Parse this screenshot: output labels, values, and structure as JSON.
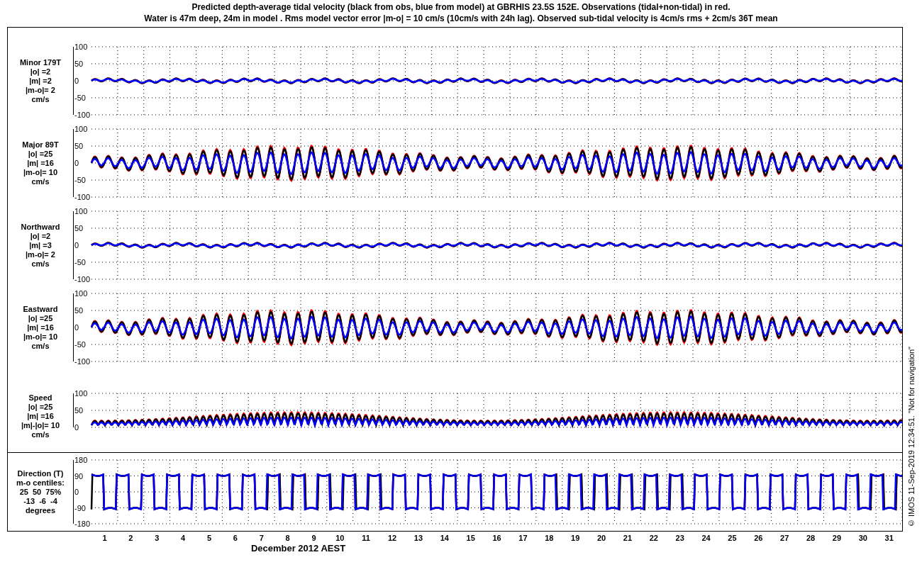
{
  "title_lines": [
    "Predicted depth-average tidal velocity (black from obs, blue from model) at GBRHIS 23.5S 152E. Observations (tidal+non-tidal) in red.",
    "Water is 47m deep, 24m in model . Rms model vector error |m-o| = 10 cm/s (10cm/s with 24h lag). Observed sub-tidal velocity is 4cm/s rms + 2cm/s 36T mean"
  ],
  "panels": [
    {
      "kind": "flat",
      "label_lines": [
        "Minor 179T",
        "|o| =2",
        "|m| =2",
        "|m-o|= 2",
        "cm/s"
      ],
      "yticks": [
        "100",
        "50",
        "0",
        "-50",
        "-100"
      ]
    },
    {
      "kind": "tidal",
      "label_lines": [
        "Major 89T",
        "|o| =25",
        "|m| =16",
        "|m-o|= 10",
        "cm/s"
      ],
      "yticks": [
        "100",
        "50",
        "0",
        "-50",
        "-100"
      ]
    },
    {
      "kind": "flat",
      "label_lines": [
        "Northward",
        "|o| =2",
        "|m| =3",
        "|m-o|= 2",
        "cm/s"
      ],
      "yticks": [
        "100",
        "50",
        "0",
        "-50",
        "-100"
      ]
    },
    {
      "kind": "tidal",
      "label_lines": [
        "Eastward",
        "|o| =25",
        "|m| =16",
        "|m-o|= 10",
        "cm/s"
      ],
      "yticks": [
        "100",
        "50",
        "0",
        "-50",
        "-100"
      ]
    },
    {
      "kind": "speed",
      "label_lines": [
        "Speed",
        "|o| =25",
        "|m| =16",
        "|m|-|o|= 10",
        "cm/s"
      ],
      "yticks": [
        "100",
        "50",
        "0"
      ]
    }
  ],
  "direction_panel": {
    "kind": "direction",
    "label_lines": [
      "Direction (T)",
      "m-o centiles:",
      "25  50  75%",
      "-13  -6  -4",
      "degrees"
    ],
    "yticks": [
      "180",
      "90",
      "0",
      "-90",
      "-180"
    ]
  },
  "x_axis": {
    "day_labels": [
      "1",
      "2",
      "3",
      "4",
      "5",
      "6",
      "7",
      "8",
      "9",
      "10",
      "11",
      "12",
      "13",
      "14",
      "15",
      "16",
      "17",
      "18",
      "19",
      "20",
      "21",
      "22",
      "23",
      "24",
      "25",
      "26",
      "27",
      "28",
      "29",
      "30",
      "31"
    ],
    "label": "December 2012 AEST"
  },
  "side_note": "© IMOS 11-Sep-2019 12:34:51. \"Not for navigation\""
}
